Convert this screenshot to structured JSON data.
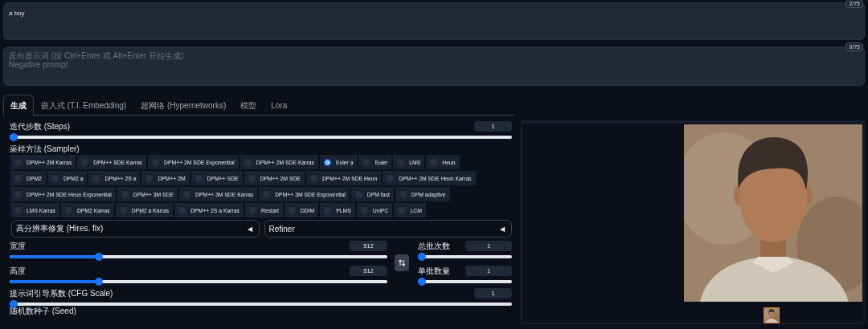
{
  "prompt": {
    "value": "a boy",
    "token_count": "2/75"
  },
  "negative_prompt": {
    "placeholder": "反向提示词 (按 Ctrl+Enter 或 Alt+Enter 开始生成)\nNegative prompt",
    "token_count": "0/75"
  },
  "tabs": [
    {
      "label": "生成",
      "selected": true
    },
    {
      "label": "嵌入式 (T.I. Embedding)",
      "selected": false
    },
    {
      "label": "超网络 (Hypernetworks)",
      "selected": false
    },
    {
      "label": "模型",
      "selected": false
    },
    {
      "label": "Lora",
      "selected": false
    }
  ],
  "steps": {
    "label": "迭代步数 (Steps)",
    "value": "1",
    "level": 0
  },
  "sampler": {
    "label": "采样方法 (Sampler)",
    "options": [
      {
        "label": "DPM++ 2M Karras",
        "selected": false
      },
      {
        "label": "DPM++ SDE Karras",
        "selected": false
      },
      {
        "label": "DPM++ 2M SDE Exponential",
        "selected": false
      },
      {
        "label": "DPM++ 2M SDE Karras",
        "selected": false
      },
      {
        "label": "Euler a",
        "selected": true
      },
      {
        "label": "Euler",
        "selected": false
      },
      {
        "label": "LMS",
        "selected": false
      },
      {
        "label": "Heun",
        "selected": false
      },
      {
        "label": "DPM2",
        "selected": false
      },
      {
        "label": "DPM2 a",
        "selected": false
      },
      {
        "label": "DPM++ 2S a",
        "selected": false
      },
      {
        "label": "DPM++ 2M",
        "selected": false
      },
      {
        "label": "DPM++ SDE",
        "selected": false
      },
      {
        "label": "DPM++ 2M SDE",
        "selected": false
      },
      {
        "label": "DPM++ 2M SDE Heun",
        "selected": false
      },
      {
        "label": "DPM++ 2M SDE Heun Karras",
        "selected": false
      },
      {
        "label": "DPM++ 2M SDE Heun Exponential",
        "selected": false
      },
      {
        "label": "DPM++ 3M SDE",
        "selected": false
      },
      {
        "label": "DPM++ 3M SDE Karras",
        "selected": false
      },
      {
        "label": "DPM++ 3M SDE Exponential",
        "selected": false
      },
      {
        "label": "DPM fast",
        "selected": false
      },
      {
        "label": "DPM adaptive",
        "selected": false
      },
      {
        "label": "LMS Karras",
        "selected": false
      },
      {
        "label": "DPM2 Karras",
        "selected": false
      },
      {
        "label": "DPM2 a Karras",
        "selected": false
      },
      {
        "label": "DPM++ 2S a Karras",
        "selected": false
      },
      {
        "label": "Restart",
        "selected": false
      },
      {
        "label": "DDIM",
        "selected": false
      },
      {
        "label": "PLMS",
        "selected": false
      },
      {
        "label": "UniPC",
        "selected": false
      },
      {
        "label": "LCM",
        "selected": false
      }
    ]
  },
  "accordions": [
    {
      "label": "高分辨率修复 (Hires. fix)",
      "arrow": "◀"
    },
    {
      "label": "Refiner",
      "arrow": "◀"
    }
  ],
  "width": {
    "label": "宽度",
    "value": "512",
    "level": 0.23
  },
  "height": {
    "label": "高度",
    "value": "512",
    "level": 0.23
  },
  "batch_count": {
    "label": "总批次数",
    "value": "1",
    "level": 0
  },
  "batch_size": {
    "label": "单批数量",
    "value": "1",
    "level": 0
  },
  "cfg_scale": {
    "label": "提示词引导系数 (CFG Scale)",
    "value": "1",
    "level": 0
  },
  "seed": {
    "label": "随机数种子 (Seed)"
  },
  "gallery": {
    "image": {
      "kind": "picture"
    },
    "thumbnails": [
      {
        "kind": "picture",
        "selected": true
      }
    ]
  }
}
